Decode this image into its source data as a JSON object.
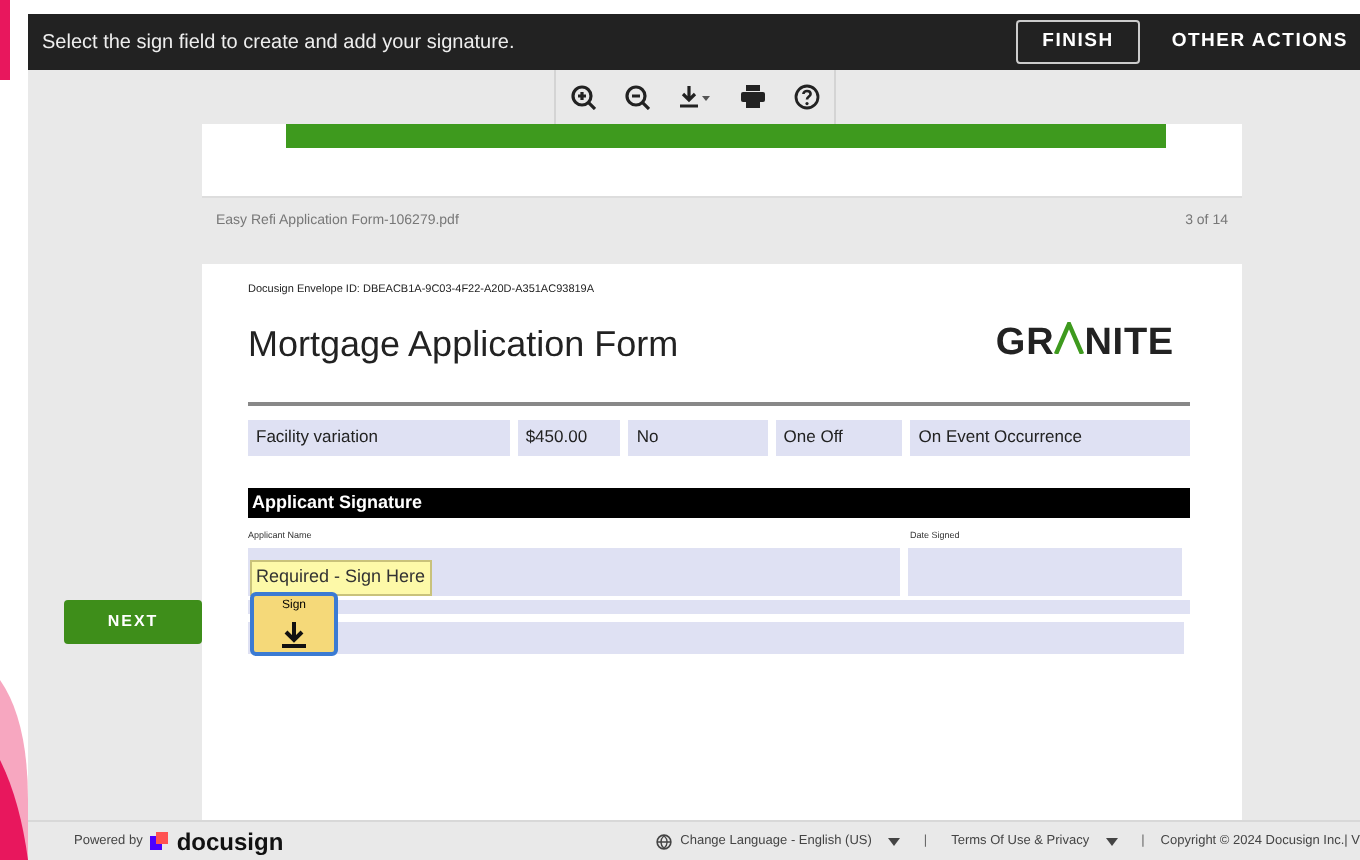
{
  "top_bar": {
    "message": "Select the sign field to create and add your signature.",
    "buttons": [
      {
        "label": "FINISH",
        "kind": "outline"
      },
      {
        "label": "OTHER ACTIONS",
        "kind": "plain"
      }
    ]
  },
  "toolbar": {
    "tools": [
      {
        "kind": "zoom-in"
      },
      {
        "kind": "zoom-out"
      },
      {
        "kind": "download"
      },
      {
        "kind": "print"
      },
      {
        "kind": "help"
      }
    ]
  },
  "document": {
    "file_name": "Easy Refi Application Form-106279.pdf",
    "page_count": "3 of 14",
    "envelope_id": "Docusign Envelope ID: DBEACB1A-9C03-4F22-A20D-A351AC93819A",
    "title": "Mortgage Application Form",
    "logo": {
      "before": "GR",
      "after": "NITE"
    },
    "table_row": [
      "Facility variation",
      "$450.00",
      "No",
      "One Off",
      "On Event Occurrence"
    ],
    "section_heading": "Applicant Signature",
    "field_labels": [
      "Applicant Name",
      "Date Signed"
    ],
    "required_tag": "Required - Sign Here",
    "sign_button": "Sign"
  },
  "next_button": "NEXT",
  "footer": {
    "powered_by": "Powered by",
    "brand": "docusign",
    "language": "Change Language - English (US)",
    "separators": [
      "|",
      "|"
    ],
    "terms": "Terms Of Use & Privacy",
    "copyright": "Copyright © 2024 Docusign Inc.| V"
  }
}
